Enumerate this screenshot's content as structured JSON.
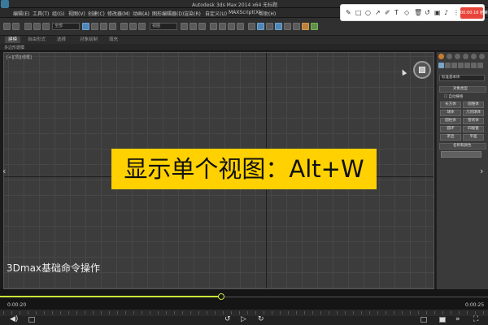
{
  "window": {
    "title": "Autodesk 3ds Max  2014 x64      无标题"
  },
  "menus": [
    "编辑(E)",
    "工具(T)",
    "组(G)",
    "视图(V)",
    "创建(C)",
    "修改器(M)",
    "动画(A)",
    "图形编辑器(D)",
    "渲染(R)",
    "自定义(U)",
    "MAXScript(X)",
    "帮助(H)"
  ],
  "toolbar": {
    "selection_filter": "全部",
    "view_dropdown": "视图"
  },
  "ribbon": {
    "tabs": [
      "建模",
      "自由形式",
      "选择",
      "对象绘制",
      "填充"
    ],
    "active_tab": "建模",
    "sub_label": "多边形建模"
  },
  "viewport": {
    "label": "[+][顶][线框]"
  },
  "command_panel": {
    "dropdown": "标准基本体",
    "rollout_object_type": "对象类型",
    "auto_grid": "自动栅格",
    "buttons": [
      "长方体",
      "圆锥体",
      "球体",
      "几何球体",
      "圆柱体",
      "管状体",
      "圆环",
      "四棱锥",
      "茶壶",
      "平面"
    ],
    "rollout_name_color": "名称和颜色"
  },
  "overlay": {
    "caption": "显示单个视图：Alt+W",
    "caption_bg": "#ffd100",
    "subtitle": "3Dmax基础命令操作"
  },
  "player": {
    "current_time": "0:00:20",
    "total_time": "0:00:25",
    "progress_fraction": 0.453,
    "accent": "#c9e63a"
  },
  "recorder": {
    "icons": [
      "pen-icon",
      "square-icon",
      "circle-icon",
      "arrow-icon",
      "marker-icon",
      "text-icon",
      "eraser-icon",
      "delete-icon",
      "undo-icon",
      "camera-icon",
      "mic-icon"
    ],
    "rec_time": "00:00:16 结束",
    "rec_color": "#e8443a"
  }
}
